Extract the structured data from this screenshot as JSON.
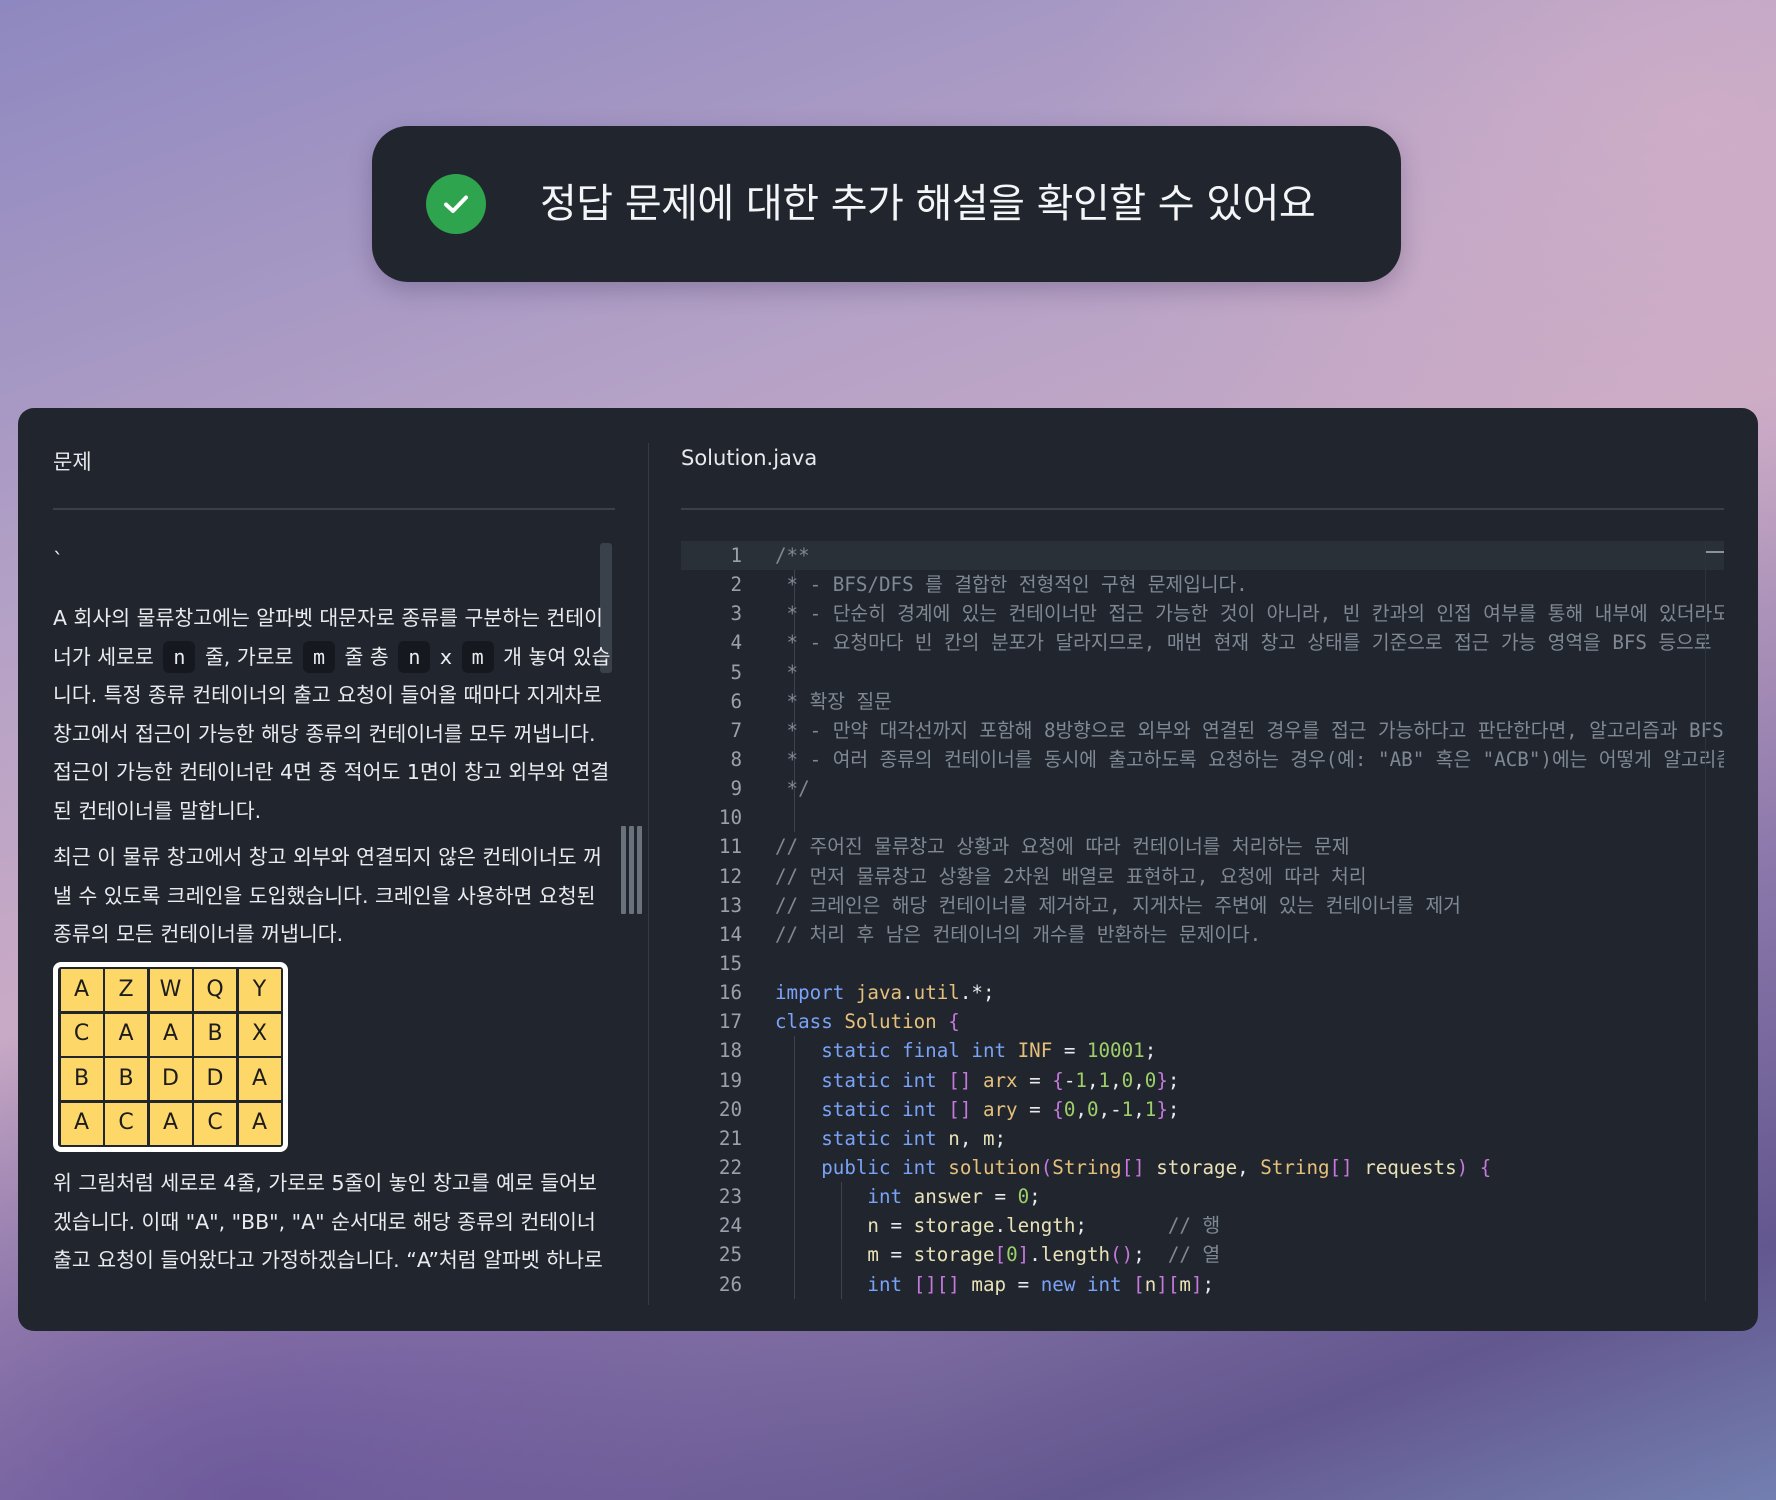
{
  "toast": {
    "message": "정답 문제에 대한 추가 해설을 확인할 수 있어요",
    "icon": "check-circle-icon",
    "icon_color": "#2ea44f"
  },
  "problem": {
    "title": "문제",
    "tick": "`",
    "p1_a": "A 회사의 물류창고에는 알파벳 대문자로 종류를 구분하는 컨테이너가 세로로",
    "p1_n1": "n",
    "p1_b": "줄, 가로로",
    "p1_m1": "m",
    "p1_c": "줄 총",
    "p1_n2": "n",
    "p1_x": "x",
    "p1_m2": "m",
    "p1_d": "개 놓여 있습니다. 특정 종류 컨테이너의 출고 요청이 들어올 때마다 지게차로 창고에서 접근이 가능한 해당 종류의 컨테이너를 모두 꺼냅니다. 접근이 가능한 컨테이너란 4면 중 적어도 1면이 창고 외부와 연결된 컨테이너를 말합니다.",
    "p2": "최근 이 물류 창고에서 창고 외부와 연결되지 않은 컨테이너도 꺼낼 수 있도록 크레인을 도입했습니다. 크레인을 사용하면 요청된 종류의 모든 컨테이너를 꺼냅니다.",
    "grid": [
      [
        "A",
        "Z",
        "W",
        "Q",
        "Y"
      ],
      [
        "C",
        "A",
        "A",
        "B",
        "X"
      ],
      [
        "B",
        "B",
        "D",
        "D",
        "A"
      ],
      [
        "A",
        "C",
        "A",
        "C",
        "A"
      ]
    ],
    "p3": "위 그림처럼 세로로 4줄, 가로로 5줄이 놓인 창고를 예로 들어보겠습니다. 이때 \"A\", \"BB\", \"A\" 순서대로 해당 종류의 컨테이너 출고 요청이 들어왔다고 가정하겠습니다. “A”처럼 알파벳 하나로"
  },
  "editor": {
    "filename": "Solution.java",
    "colors": {
      "keyword": "#7aa2f7",
      "type": "#e5c07b",
      "number": "#9ece6a",
      "comment": "#7f8893",
      "bracket": "#c678dd"
    },
    "lines": [
      [
        [
          "cm",
          "/**"
        ]
      ],
      [
        [
          "cm",
          " * - BFS/DFS 를 결합한 전형적인 구현 문제입니다."
        ]
      ],
      [
        [
          "cm",
          " * - 단순히 경계에 있는 컨테이너만 접근 가능한 것이 아니라, 빈 칸과의 인접 여부를 통해 내부에 있더라도 외"
        ]
      ],
      [
        [
          "cm",
          " * - 요청마다 빈 칸의 분포가 달라지므로, 매번 현재 창고 상태를 기준으로 접근 가능 영역을 BFS 등으로 갱신"
        ]
      ],
      [
        [
          "cm",
          " *"
        ]
      ],
      [
        [
          "cm",
          " * 확장 질문"
        ]
      ],
      [
        [
          "cm",
          " * - 만약 대각선까지 포함해 8방향으로 외부와 연결된 경우를 접근 가능하다고 판단한다면, 알고리즘과 BFS/DF"
        ]
      ],
      [
        [
          "cm",
          " * - 여러 종류의 컨테이너를 동시에 출고하도록 요청하는 경우(예: \"AB\" 혹은 \"ACB\")에는 어떻게 알고리즘을"
        ]
      ],
      [
        [
          "cm",
          " */"
        ]
      ],
      [],
      [
        [
          "cm",
          "// 주어진 물류창고 상황과 요청에 따라 컨테이너를 처리하는 문제"
        ]
      ],
      [
        [
          "cm",
          "// 먼저 물류창고 상황을 2차원 배열로 표현하고, 요청에 따라 처리"
        ]
      ],
      [
        [
          "cm",
          "// 크레인은 해당 컨테이너를 제거하고, 지게차는 주변에 있는 컨테이너를 제거"
        ]
      ],
      [
        [
          "cm",
          "// 처리 후 남은 컨테이너의 개수를 반환하는 문제이다."
        ]
      ],
      [],
      [
        [
          "kw",
          "import "
        ],
        [
          "ty",
          "java"
        ],
        [
          "ops",
          "."
        ],
        [
          "ty",
          "util"
        ],
        [
          "ops",
          ".*;"
        ]
      ],
      [
        [
          "kw",
          "class "
        ],
        [
          "ty",
          "Solution "
        ],
        [
          "br",
          "{"
        ]
      ],
      [
        [
          "ops",
          "    "
        ],
        [
          "kw",
          "static final int "
        ],
        [
          "ty",
          "INF"
        ],
        [
          "ops",
          " = "
        ],
        [
          "nm",
          "10001"
        ],
        [
          "ops",
          ";"
        ]
      ],
      [
        [
          "ops",
          "    "
        ],
        [
          "kw",
          "static int "
        ],
        [
          "br",
          "[]"
        ],
        [
          "ty",
          " arx"
        ],
        [
          "ops",
          " = "
        ],
        [
          "br",
          "{"
        ],
        [
          "ops",
          "-"
        ],
        [
          "nm",
          "1"
        ],
        [
          "ops",
          ","
        ],
        [
          "nm",
          "1"
        ],
        [
          "ops",
          ","
        ],
        [
          "nm",
          "0"
        ],
        [
          "ops",
          ","
        ],
        [
          "nm",
          "0"
        ],
        [
          "br",
          "}"
        ],
        [
          "ops",
          ";"
        ]
      ],
      [
        [
          "ops",
          "    "
        ],
        [
          "kw",
          "static int "
        ],
        [
          "br",
          "[]"
        ],
        [
          "ty",
          " ary"
        ],
        [
          "ops",
          " = "
        ],
        [
          "br",
          "{"
        ],
        [
          "nm",
          "0"
        ],
        [
          "ops",
          ","
        ],
        [
          "nm",
          "0"
        ],
        [
          "ops",
          ",-"
        ],
        [
          "nm",
          "1"
        ],
        [
          "ops",
          ","
        ],
        [
          "nm",
          "1"
        ],
        [
          "br",
          "}"
        ],
        [
          "ops",
          ";"
        ]
      ],
      [
        [
          "ops",
          "    "
        ],
        [
          "kw",
          "static int "
        ],
        [
          "va",
          "n"
        ],
        [
          "ops",
          ", "
        ],
        [
          "va",
          "m"
        ],
        [
          "ops",
          ";"
        ]
      ],
      [
        [
          "ops",
          "    "
        ],
        [
          "kw",
          "public int "
        ],
        [
          "ty",
          "solution"
        ],
        [
          "br",
          "("
        ],
        [
          "ty",
          "String"
        ],
        [
          "br",
          "[]"
        ],
        [
          "va",
          " storage"
        ],
        [
          "ops",
          ", "
        ],
        [
          "ty",
          "String"
        ],
        [
          "br",
          "[]"
        ],
        [
          "va",
          " requests"
        ],
        [
          "br",
          ") {"
        ]
      ],
      [
        [
          "ops",
          "        "
        ],
        [
          "kw",
          "int "
        ],
        [
          "va",
          "answer"
        ],
        [
          "ops",
          " = "
        ],
        [
          "nm",
          "0"
        ],
        [
          "ops",
          ";"
        ]
      ],
      [
        [
          "ops",
          "        "
        ],
        [
          "va",
          "n"
        ],
        [
          "ops",
          " = "
        ],
        [
          "va",
          "storage"
        ],
        [
          "ops",
          "."
        ],
        [
          "va",
          "length"
        ],
        [
          "ops",
          ";       "
        ],
        [
          "cm",
          "// 행"
        ]
      ],
      [
        [
          "ops",
          "        "
        ],
        [
          "va",
          "m"
        ],
        [
          "ops",
          " = "
        ],
        [
          "va",
          "storage"
        ],
        [
          "br",
          "["
        ],
        [
          "nm",
          "0"
        ],
        [
          "br",
          "]"
        ],
        [
          "ops",
          "."
        ],
        [
          "va",
          "length"
        ],
        [
          "br",
          "()"
        ],
        [
          "ops",
          ";  "
        ],
        [
          "cm",
          "// 열"
        ]
      ],
      [
        [
          "ops",
          "        "
        ],
        [
          "kw",
          "int "
        ],
        [
          "br",
          "[][]"
        ],
        [
          "va",
          " map"
        ],
        [
          "ops",
          " = "
        ],
        [
          "kw",
          "new int "
        ],
        [
          "br",
          "["
        ],
        [
          "va",
          "n"
        ],
        [
          "br",
          "]["
        ],
        [
          "va",
          "m"
        ],
        [
          "br",
          "]"
        ],
        [
          "ops",
          ";"
        ]
      ]
    ]
  }
}
